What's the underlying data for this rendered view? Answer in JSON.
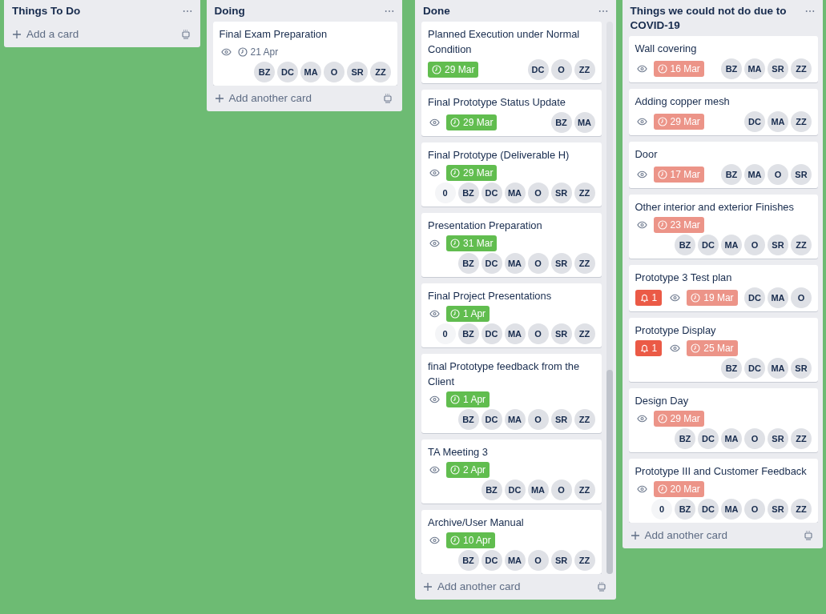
{
  "lists": [
    {
      "title": "Things To Do",
      "add_label": "Add a card"
    },
    {
      "title": "Doing",
      "add_label": "Add another card",
      "cards": [
        {
          "title": "Final Exam Preparation",
          "watching": true,
          "due": "21 Apr",
          "due_complete": false,
          "overdue": false,
          "members": [
            {
              "initials": "BZ",
              "dimmed": false
            },
            {
              "initials": "DC",
              "dimmed": false
            },
            {
              "initials": "MA",
              "dimmed": false
            },
            {
              "initials": "O",
              "dimmed": false
            },
            {
              "initials": "SR",
              "dimmed": false
            },
            {
              "initials": "ZZ",
              "dimmed": false
            }
          ]
        }
      ]
    },
    {
      "title": "Done",
      "add_label": "Add another card",
      "scrollable": true,
      "cards": [
        {
          "title": "Planned Execution under Normal Condition",
          "watching": false,
          "due": "29 Mar",
          "due_complete": true,
          "overdue": false,
          "members": [
            {
              "initials": "DC",
              "dimmed": false
            },
            {
              "initials": "O",
              "dimmed": false
            },
            {
              "initials": "ZZ",
              "dimmed": false
            }
          ]
        },
        {
          "title": "Final Prototype Status Update",
          "watching": true,
          "due": "29 Mar",
          "due_complete": true,
          "overdue": false,
          "members": [
            {
              "initials": "BZ",
              "dimmed": false
            },
            {
              "initials": "MA",
              "dimmed": false
            }
          ]
        },
        {
          "title": "Final Prototype (Deliverable H)",
          "watching": true,
          "due": "29 Mar",
          "due_complete": true,
          "overdue": false,
          "members": [
            {
              "initials": "0",
              "dimmed": true
            },
            {
              "initials": "BZ",
              "dimmed": false
            },
            {
              "initials": "DC",
              "dimmed": false
            },
            {
              "initials": "MA",
              "dimmed": false
            },
            {
              "initials": "O",
              "dimmed": false
            },
            {
              "initials": "SR",
              "dimmed": false
            },
            {
              "initials": "ZZ",
              "dimmed": false
            }
          ]
        },
        {
          "title": "Presentation Preparation",
          "watching": true,
          "due": "31 Mar",
          "due_complete": true,
          "overdue": false,
          "members": [
            {
              "initials": "BZ",
              "dimmed": false
            },
            {
              "initials": "DC",
              "dimmed": false
            },
            {
              "initials": "MA",
              "dimmed": false
            },
            {
              "initials": "O",
              "dimmed": false
            },
            {
              "initials": "SR",
              "dimmed": false
            },
            {
              "initials": "ZZ",
              "dimmed": false
            }
          ]
        },
        {
          "title": "Final Project Presentations",
          "watching": true,
          "due": "1 Apr",
          "due_complete": true,
          "overdue": false,
          "members": [
            {
              "initials": "0",
              "dimmed": true
            },
            {
              "initials": "BZ",
              "dimmed": false
            },
            {
              "initials": "DC",
              "dimmed": false
            },
            {
              "initials": "MA",
              "dimmed": false
            },
            {
              "initials": "O",
              "dimmed": false
            },
            {
              "initials": "SR",
              "dimmed": false
            },
            {
              "initials": "ZZ",
              "dimmed": false
            }
          ]
        },
        {
          "title": "final Prototype feedback from the Client",
          "watching": true,
          "due": "1 Apr",
          "due_complete": true,
          "overdue": false,
          "members": [
            {
              "initials": "BZ",
              "dimmed": false
            },
            {
              "initials": "DC",
              "dimmed": false
            },
            {
              "initials": "MA",
              "dimmed": false
            },
            {
              "initials": "O",
              "dimmed": false
            },
            {
              "initials": "SR",
              "dimmed": false
            },
            {
              "initials": "ZZ",
              "dimmed": false
            }
          ]
        },
        {
          "title": "TA Meeting 3",
          "watching": true,
          "due": "2 Apr",
          "due_complete": true,
          "overdue": false,
          "members": [
            {
              "initials": "BZ",
              "dimmed": false
            },
            {
              "initials": "DC",
              "dimmed": false
            },
            {
              "initials": "MA",
              "dimmed": false
            },
            {
              "initials": "O",
              "dimmed": false
            },
            {
              "initials": "ZZ",
              "dimmed": false
            }
          ]
        },
        {
          "title": "Archive/User Manual",
          "watching": true,
          "due": "10 Apr",
          "due_complete": true,
          "overdue": false,
          "members": [
            {
              "initials": "BZ",
              "dimmed": false
            },
            {
              "initials": "DC",
              "dimmed": false
            },
            {
              "initials": "MA",
              "dimmed": false
            },
            {
              "initials": "O",
              "dimmed": false
            },
            {
              "initials": "SR",
              "dimmed": false
            },
            {
              "initials": "ZZ",
              "dimmed": false
            }
          ]
        }
      ]
    },
    {
      "title": "Things we could not do due to COVID-19",
      "add_label": "Add another card",
      "cards": [
        {
          "title": "Wall covering",
          "watching": true,
          "due": "16 Mar",
          "due_complete": false,
          "overdue": true,
          "members": [
            {
              "initials": "BZ",
              "dimmed": false
            },
            {
              "initials": "MA",
              "dimmed": false
            },
            {
              "initials": "SR",
              "dimmed": false
            },
            {
              "initials": "ZZ",
              "dimmed": false
            }
          ]
        },
        {
          "title": "Adding copper mesh",
          "watching": true,
          "due": "29 Mar",
          "due_complete": false,
          "overdue": true,
          "members": [
            {
              "initials": "DC",
              "dimmed": false
            },
            {
              "initials": "MA",
              "dimmed": false
            },
            {
              "initials": "ZZ",
              "dimmed": false
            }
          ]
        },
        {
          "title": "Door",
          "watching": true,
          "due": "17 Mar",
          "due_complete": false,
          "overdue": true,
          "members": [
            {
              "initials": "BZ",
              "dimmed": false
            },
            {
              "initials": "MA",
              "dimmed": false
            },
            {
              "initials": "O",
              "dimmed": false
            },
            {
              "initials": "SR",
              "dimmed": false
            }
          ]
        },
        {
          "title": "Other interior and exterior Finishes",
          "watching": true,
          "due": "23 Mar",
          "due_complete": false,
          "overdue": true,
          "members": [
            {
              "initials": "BZ",
              "dimmed": false
            },
            {
              "initials": "DC",
              "dimmed": false
            },
            {
              "initials": "MA",
              "dimmed": false
            },
            {
              "initials": "O",
              "dimmed": false
            },
            {
              "initials": "SR",
              "dimmed": false
            },
            {
              "initials": "ZZ",
              "dimmed": false
            }
          ]
        },
        {
          "title": "Prototype 3 Test plan",
          "notifications": "1",
          "watching": true,
          "due": "19 Mar",
          "due_complete": false,
          "overdue": true,
          "members": [
            {
              "initials": "DC",
              "dimmed": false
            },
            {
              "initials": "MA",
              "dimmed": false
            },
            {
              "initials": "O",
              "dimmed": false
            }
          ]
        },
        {
          "title": "Prototype Display",
          "notifications": "1",
          "watching": true,
          "due": "25 Mar",
          "due_complete": false,
          "overdue": true,
          "members": [
            {
              "initials": "BZ",
              "dimmed": false
            },
            {
              "initials": "DC",
              "dimmed": false
            },
            {
              "initials": "MA",
              "dimmed": false
            },
            {
              "initials": "SR",
              "dimmed": false
            }
          ]
        },
        {
          "title": "Design Day",
          "watching": true,
          "due": "29 Mar",
          "due_complete": false,
          "overdue": true,
          "members": [
            {
              "initials": "BZ",
              "dimmed": false
            },
            {
              "initials": "DC",
              "dimmed": false
            },
            {
              "initials": "MA",
              "dimmed": false
            },
            {
              "initials": "O",
              "dimmed": false
            },
            {
              "initials": "SR",
              "dimmed": false
            },
            {
              "initials": "ZZ",
              "dimmed": false
            }
          ]
        },
        {
          "title": "Prototype III and Customer Feedback",
          "watching": true,
          "due": "20 Mar",
          "due_complete": false,
          "overdue": true,
          "members": [
            {
              "initials": "0",
              "dimmed": true
            },
            {
              "initials": "BZ",
              "dimmed": false
            },
            {
              "initials": "DC",
              "dimmed": false
            },
            {
              "initials": "MA",
              "dimmed": false
            },
            {
              "initials": "O",
              "dimmed": false
            },
            {
              "initials": "SR",
              "dimmed": false
            },
            {
              "initials": "ZZ",
              "dimmed": false
            }
          ]
        }
      ]
    }
  ]
}
